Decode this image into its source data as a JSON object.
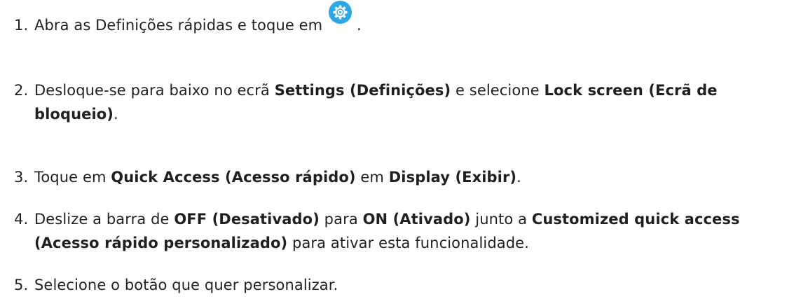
{
  "steps": [
    {
      "number": "1.",
      "text_before": "Abra as Definições rápidas e toque em ",
      "icon": "settings-gear-icon",
      "text_after": "."
    },
    {
      "number": "2.",
      "t1": "Desloque-se para baixo no ecrã ",
      "b1": "Settings (Definições)",
      "t2": " e selecione ",
      "b2": "Lock screen (Ecrã de bloqueio)",
      "t3": "."
    },
    {
      "number": "3.",
      "t1": "Toque em ",
      "b1": "Quick Access (Acesso rápido)",
      "t2": " em ",
      "b2": "Display (Exibir)",
      "t3": "."
    },
    {
      "number": "4.",
      "t1": "Deslize a barra de ",
      "b1": "OFF (Desativado)",
      "t2": " para ",
      "b2": "ON (Ativado)",
      "t3": " junto a ",
      "b3": "Customized quick access (Acesso rápido personalizado)",
      "t4": " para ativar esta funcionalidade."
    },
    {
      "number": "5.",
      "t1": "Selecione o botão que quer personalizar."
    }
  ],
  "colors": {
    "text": "#231f20",
    "icon_background": "#2aa7e6",
    "icon_foreground": "#ffffff"
  }
}
